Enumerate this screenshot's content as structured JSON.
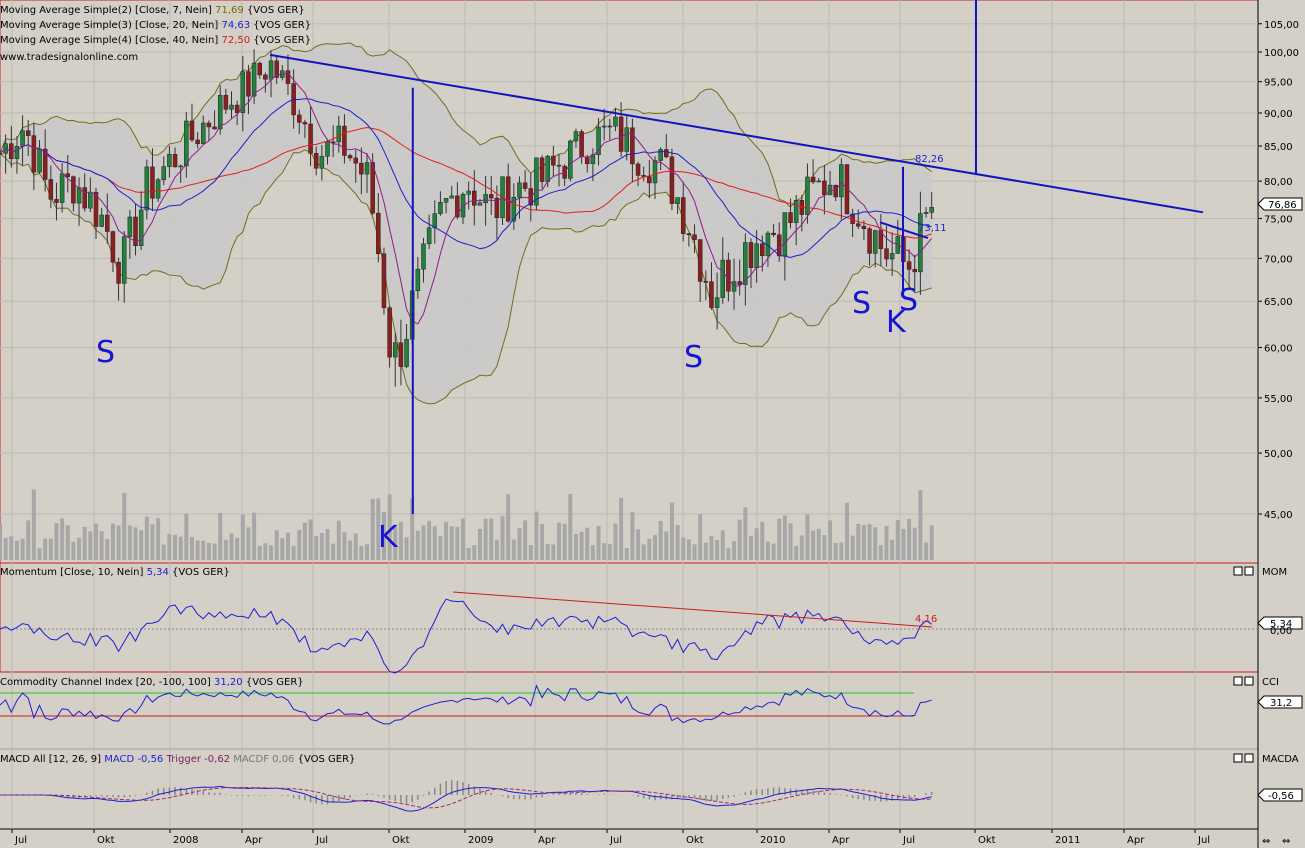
{
  "colors": {
    "background": "#d4d0c8",
    "candle_up": "#21823c",
    "candle_down": "#8c1e1e",
    "ma7": "#8c1e8c",
    "ma20": "#1e1ed2",
    "ma40": "#e11e1e",
    "bollinger": "#6e6e1e",
    "trendline": "#1414be",
    "volume": "#a7a7a7",
    "momentum": "#1e1ed2",
    "cci": "#1e1ed2",
    "macd": "#1e1ed2",
    "trigger": "#9a2e6e",
    "panel_border": "#c81e1e"
  },
  "legend": {
    "ma1_prefix": "Moving Average Simple(2) [Close, 7, Nein]",
    "ma1_value": "71,69",
    "ma1_suffix": "{VOS GER}",
    "ma2_prefix": "Moving Average Simple(3) [Close, 20, Nein]",
    "ma2_value": "74,63",
    "ma2_suffix": "{VOS GER}",
    "ma3_prefix": "Moving Average Simple(4) [Close, 40, Nein]",
    "ma3_value": "72,50",
    "ma3_suffix": "{VOS GER}",
    "site": "www.tradesignalonline.com"
  },
  "momentum_panel": {
    "title": "Momentum [Close, 10, Nein]",
    "value": "5,34",
    "suffix": "{VOS GER}",
    "tag": "MOM",
    "right_value": "5,34",
    "right_value2": "0,00",
    "line_value": "4,16"
  },
  "cci_panel": {
    "title": "Commodity Channel Index [20, -100, 100]",
    "value": "31,20",
    "suffix": "{VOS GER}",
    "tag": "CCI",
    "right_value": "31,2"
  },
  "macd_panel": {
    "title": "MACD All [12, 26, 9]",
    "macd_label": "MACD",
    "macd_value": "-0,56",
    "trigger_label": "Trigger",
    "trigger_value": "-0,62",
    "macdf_label": "MACDF",
    "macdf_value": "0,06",
    "suffix": "{VOS GER}",
    "tag": "MACDA",
    "right_value": "-0,56"
  },
  "price_axis_labels": [
    "105,00",
    "100,00",
    "95,00",
    "90,00",
    "85,00",
    "80,00",
    "75,00",
    "70,00",
    "65,00",
    "60,00",
    "55,00",
    "50,00",
    "45,00"
  ],
  "last_price": "76,86",
  "annotations": {
    "trend_value": "82,26",
    "support_value": "73,11",
    "letters": [
      "S",
      "K",
      "S",
      "S",
      "K",
      "S"
    ]
  },
  "time_axis": [
    "Jul",
    "Okt",
    "2008",
    "Apr",
    "Jul",
    "Okt",
    "2009",
    "Apr",
    "Jul",
    "Okt",
    "2010",
    "Apr",
    "Jul",
    "Okt",
    "2011",
    "Apr",
    "Jul"
  ],
  "chart_data": {
    "type": "candlestick",
    "series_names": [
      "Moving Average Simple(2) [Close, 7, Nein]",
      "Moving Average Simple(3) [Close, 20, Nein]",
      "Moving Average Simple(4) [Close, 40, Nein]"
    ],
    "ylim": [
      40,
      108
    ],
    "last_values": {
      "ma7": 71.69,
      "ma20": 74.63,
      "ma40": 72.5,
      "close": 76.86,
      "momentum": 5.34,
      "cci": 31.2,
      "macd": -0.56,
      "trigger": -0.62,
      "macdf": 0.06
    },
    "trendline": {
      "from": {
        "date": "2008-05",
        "value": 99.5
      },
      "to": {
        "date": "2011-07",
        "value": 75.8
      }
    },
    "close_path": [
      {
        "date": "2007-06",
        "value": 84
      },
      {
        "date": "2007-07",
        "value": 88
      },
      {
        "date": "2007-08",
        "value": 78
      },
      {
        "date": "2007-09",
        "value": 80
      },
      {
        "date": "2007-10",
        "value": 76
      },
      {
        "date": "2007-11",
        "value": 69
      },
      {
        "date": "2007-12",
        "value": 79
      },
      {
        "date": "2008-01",
        "value": 83
      },
      {
        "date": "2008-02",
        "value": 87
      },
      {
        "date": "2008-03",
        "value": 91
      },
      {
        "date": "2008-04",
        "value": 94
      },
      {
        "date": "2008-05",
        "value": 98
      },
      {
        "date": "2008-06",
        "value": 92
      },
      {
        "date": "2008-07",
        "value": 84
      },
      {
        "date": "2008-08",
        "value": 85
      },
      {
        "date": "2008-09",
        "value": 80
      },
      {
        "date": "2008-10",
        "value": 58
      },
      {
        "date": "2008-11",
        "value": 66
      },
      {
        "date": "2008-12",
        "value": 76
      },
      {
        "date": "2009-01",
        "value": 80
      },
      {
        "date": "2009-02",
        "value": 76
      },
      {
        "date": "2009-03",
        "value": 79
      },
      {
        "date": "2009-04",
        "value": 80
      },
      {
        "date": "2009-05",
        "value": 83
      },
      {
        "date": "2009-06",
        "value": 86
      },
      {
        "date": "2009-07",
        "value": 87
      },
      {
        "date": "2009-08",
        "value": 84
      },
      {
        "date": "2009-09",
        "value": 82
      },
      {
        "date": "2009-10",
        "value": 75
      },
      {
        "date": "2009-11",
        "value": 66
      },
      {
        "date": "2009-12",
        "value": 70
      },
      {
        "date": "2010-01",
        "value": 73
      },
      {
        "date": "2010-02",
        "value": 74
      },
      {
        "date": "2010-03",
        "value": 78
      },
      {
        "date": "2010-04",
        "value": 81
      },
      {
        "date": "2010-05",
        "value": 76
      },
      {
        "date": "2010-06",
        "value": 71
      },
      {
        "date": "2010-07",
        "value": 69
      },
      {
        "date": "2010-08",
        "value": 76.86
      }
    ]
  }
}
